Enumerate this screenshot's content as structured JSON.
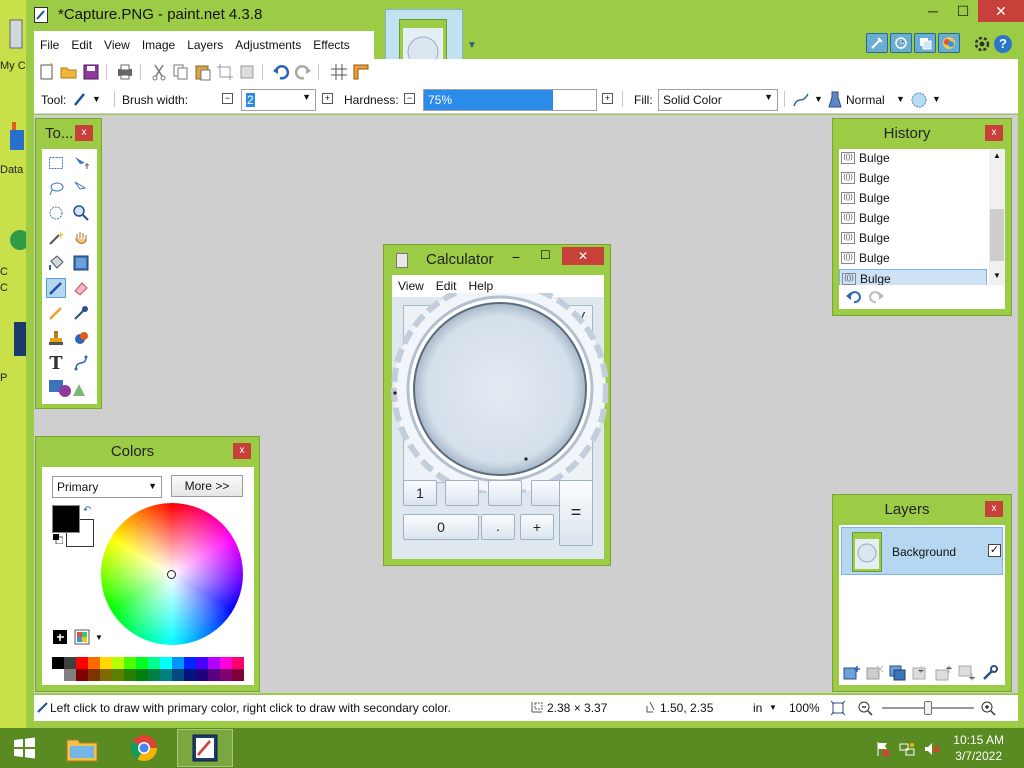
{
  "window": {
    "title": "*Capture.PNG - paint.net 4.3.8",
    "minimize": "─",
    "restore": "☐",
    "close": "✕"
  },
  "desktop": {
    "label_1": "My C",
    "label_2": "Data",
    "label_3": "C",
    "label_4": "C",
    "label_5": "P"
  },
  "menu": [
    "File",
    "Edit",
    "View",
    "Image",
    "Layers",
    "Adjustments",
    "Effects"
  ],
  "options_bar": {
    "tool_label": "Tool:",
    "brush_width_label": "Brush width:",
    "brush_width_value": "2",
    "hardness_label": "Hardness:",
    "hardness_value": "75%",
    "hardness_fraction": 0.75,
    "fill_label": "Fill:",
    "fill_value": "Solid Color",
    "blend_mode": "Normal",
    "minus": "−",
    "plus": "+"
  },
  "tools_panel": {
    "title": "To...",
    "close": "x",
    "tools": [
      "rectangle-select",
      "move-selected",
      "lasso-select",
      "move-selection",
      "ellipse-select",
      "zoom",
      "magic-wand",
      "pan",
      "paint-bucket",
      "gradient",
      "paintbrush",
      "eraser",
      "pencil",
      "color-picker",
      "clone-stamp",
      "recolor",
      "text",
      "line-curve",
      "shapes"
    ],
    "active_tool": "paintbrush",
    "text_tool_glyph": "T"
  },
  "colors_panel": {
    "title": "Colors",
    "close": "x",
    "mode": "Primary",
    "more_button": "More >>",
    "primary_color": "#000000",
    "secondary_color": "#ffffff",
    "palette_top": [
      "#000000",
      "#404040",
      "#ff0000",
      "#ff6a00",
      "#ffd800",
      "#b6ff00",
      "#4cff00",
      "#00ff21",
      "#00ff90",
      "#00ffff",
      "#0094ff",
      "#0026ff",
      "#4800ff",
      "#b200ff",
      "#ff00dc",
      "#ff006e"
    ],
    "palette_bottom": [
      "#ffffff",
      "#808080",
      "#7f0000",
      "#7f3300",
      "#7f6a00",
      "#5b7f00",
      "#267f00",
      "#007f0e",
      "#007f46",
      "#007f7f",
      "#004a7f",
      "#00137f",
      "#21007f",
      "#57007f",
      "#7f006e",
      "#7f0037"
    ]
  },
  "history_panel": {
    "title": "History",
    "close": "x",
    "items": [
      "Bulge",
      "Bulge",
      "Bulge",
      "Bulge",
      "Bulge",
      "Bulge",
      "Bulge"
    ],
    "selected_index": 6,
    "item_icon": "(())"
  },
  "layers_panel": {
    "title": "Layers",
    "close": "x",
    "layers": [
      {
        "name": "Background",
        "visible": true
      }
    ]
  },
  "calculator": {
    "title": "Calculator",
    "minimize": "−",
    "restore": "☐",
    "close": "✕",
    "menu": [
      "View",
      "Edit",
      "Help"
    ],
    "display": "1 /",
    "buttons": {
      "one": "1",
      "zero": "0",
      "dot": ".",
      "plus": "+",
      "equals": "="
    }
  },
  "statusbar": {
    "hint": "Left click to draw with primary color, right click to draw with secondary color.",
    "selection_size": "2.38 × 3.37",
    "cursor_pos": "1.50, 2.35",
    "units": "in",
    "zoom": "100%"
  },
  "taskbar": {
    "time": "10:15 AM",
    "date": "3/7/2022"
  },
  "colors": {
    "window_green": "#9ccc45",
    "canvas_gray": "#cfcfcf",
    "close_red": "#c7403a",
    "selection_blue": "#2a8be8",
    "taskbar": "#5a8a22"
  }
}
